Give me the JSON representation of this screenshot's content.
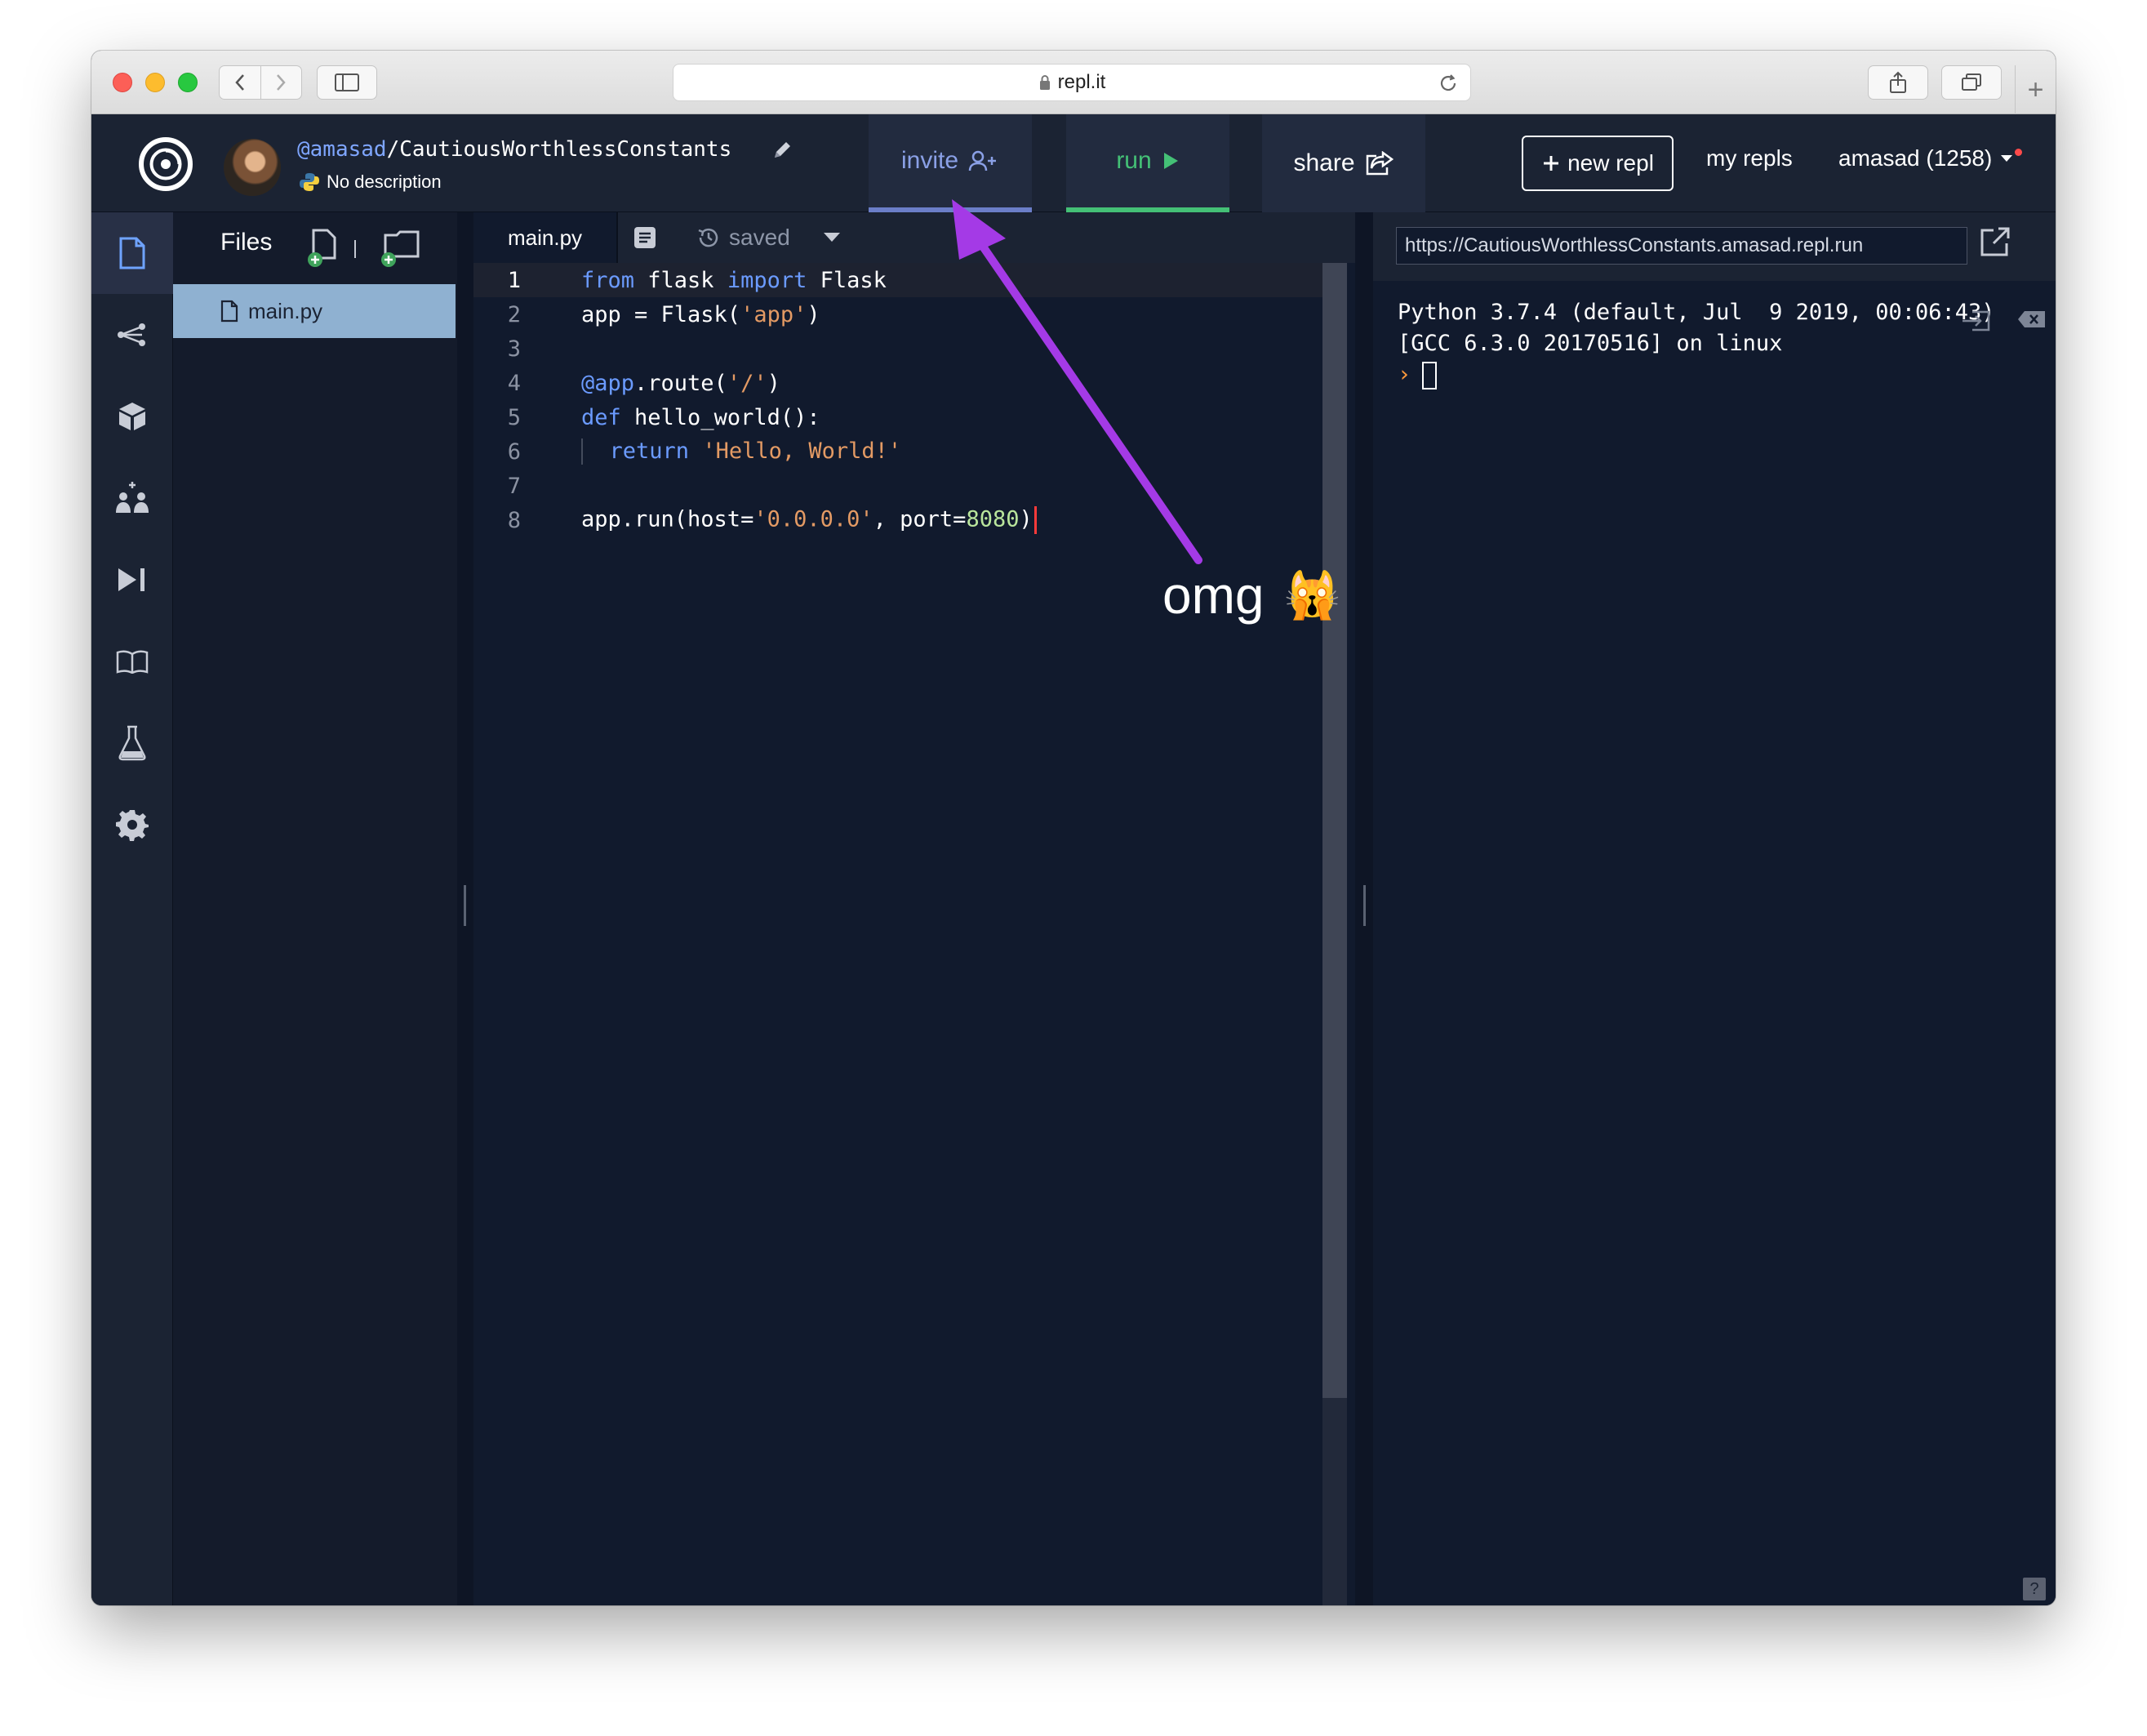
{
  "browser": {
    "url": "repl.it",
    "new_tab_symbol": "+"
  },
  "header": {
    "owner": "@amasad",
    "separator": "/",
    "repl_name": "CautiousWorthlessConstants",
    "description": "No description",
    "invite_label": "invite",
    "run_label": "run",
    "share_label": "share",
    "new_repl_label": "new repl",
    "my_repls_label": "my repls",
    "account_label": "amasad (1258)"
  },
  "rail": {
    "icons": [
      "files-icon",
      "version-control-icon",
      "packages-icon",
      "multiplayer-icon",
      "debugger-icon",
      "docs-icon",
      "unit-tests-icon",
      "settings-icon"
    ]
  },
  "files": {
    "title": "Files",
    "items": [
      {
        "name": "main.py"
      }
    ]
  },
  "editor": {
    "tab_label": "main.py",
    "status": "saved",
    "lines": [
      {
        "num": "1"
      },
      {
        "num": "2"
      },
      {
        "num": "3"
      },
      {
        "num": "4"
      },
      {
        "num": "5"
      },
      {
        "num": "6"
      },
      {
        "num": "7"
      },
      {
        "num": "8"
      }
    ]
  },
  "console": {
    "url": "https://CautiousWorthlessConstants.amasad.repl.run",
    "output_line1": "Python 3.7.4 (default, Jul  9 2019, 00:06:43)",
    "output_line2": "[GCC 6.3.0 20170516] on linux",
    "prompt": "›",
    "help": "?"
  },
  "annotation": {
    "text": "omg",
    "emoji": "🙀",
    "arrow_color": "#a43ae6"
  }
}
